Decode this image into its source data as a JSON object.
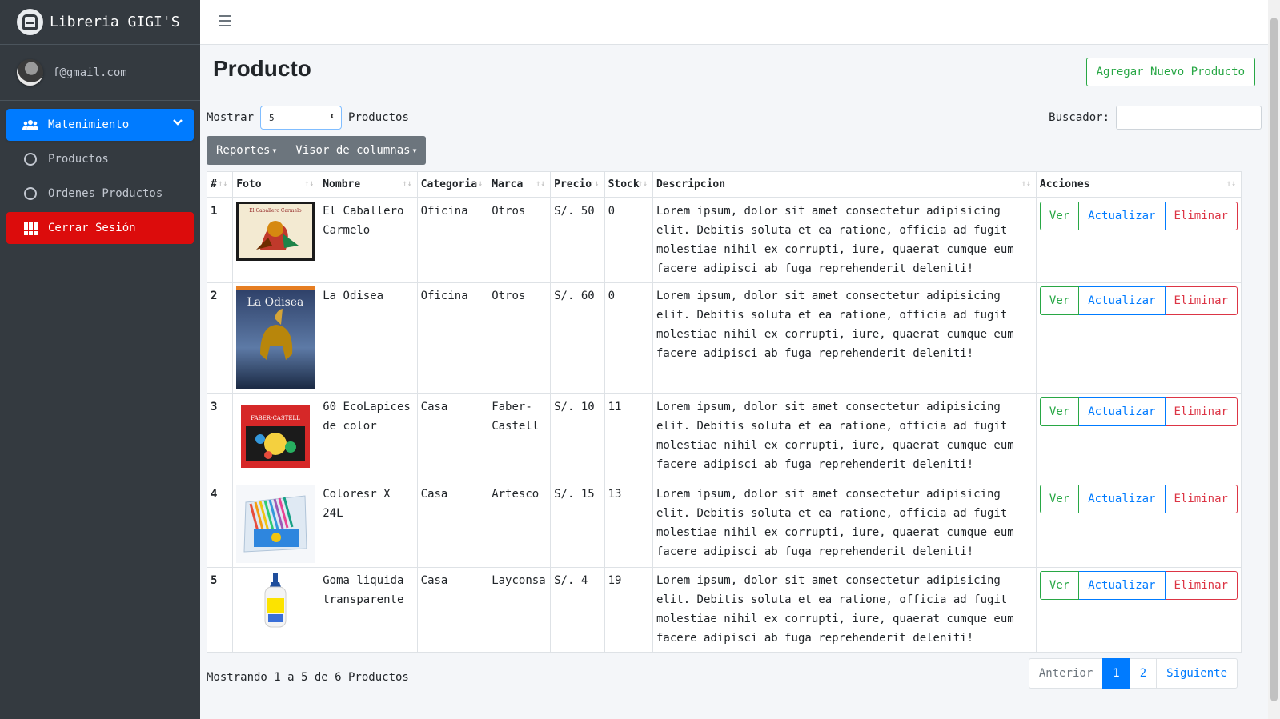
{
  "brand": {
    "name": "Libreria GIGI'S"
  },
  "user": {
    "email": "f@gmail.com"
  },
  "sidebar": {
    "items": [
      {
        "label": "Matenimiento",
        "icon": "users-icon"
      },
      {
        "label": "Productos",
        "icon": "circle-icon"
      },
      {
        "label": "Ordenes Productos",
        "icon": "circle-icon"
      },
      {
        "label": "Cerrar Sesión",
        "icon": "grid-icon"
      }
    ]
  },
  "page": {
    "title": "Producto",
    "add_button": "Agregar Nuevo Producto",
    "show_label": "Mostrar",
    "show_value": "5",
    "show_suffix": "Productos",
    "search_label": "Buscador:",
    "search_value": "",
    "reports_button": "Reportes",
    "columns_button": "Visor de columnas"
  },
  "table": {
    "headers": [
      "#",
      "Foto",
      "Nombre",
      "Categoria",
      "Marca",
      "Precio",
      "Stock",
      "Descripcion",
      "Acciones"
    ],
    "rows": [
      {
        "num": "1",
        "nombre": "El Caballero Carmelo",
        "categoria": "Oficina",
        "marca": "Otros",
        "precio": "S/. 50",
        "stock": "0",
        "descripcion": "Lorem ipsum, dolor sit amet consectetur adipisicing elit. Debitis soluta et ea ratione, officia ad fugit molestiae nihil ex corrupti, iure, quaerat cumque eum facere adipisci ab fuga reprehenderit deleniti!"
      },
      {
        "num": "2",
        "nombre": "La Odisea",
        "categoria": "Oficina",
        "marca": "Otros",
        "precio": "S/. 60",
        "stock": "0",
        "descripcion": "Lorem ipsum, dolor sit amet consectetur adipisicing elit. Debitis soluta et ea ratione, officia ad fugit molestiae nihil ex corrupti, iure, quaerat cumque eum facere adipisci ab fuga reprehenderit deleniti!"
      },
      {
        "num": "3",
        "nombre": "60 EcoLapices de color",
        "categoria": "Casa",
        "marca": "Faber-Castell",
        "precio": "S/. 10",
        "stock": "11",
        "descripcion": "Lorem ipsum, dolor sit amet consectetur adipisicing elit. Debitis soluta et ea ratione, officia ad fugit molestiae nihil ex corrupti, iure, quaerat cumque eum facere adipisci ab fuga reprehenderit deleniti!"
      },
      {
        "num": "4",
        "nombre": "Coloresr X 24L",
        "categoria": "Casa",
        "marca": "Artesco",
        "precio": "S/. 15",
        "stock": "13",
        "descripcion": "Lorem ipsum, dolor sit amet consectetur adipisicing elit. Debitis soluta et ea ratione, officia ad fugit molestiae nihil ex corrupti, iure, quaerat cumque eum facere adipisci ab fuga reprehenderit deleniti!"
      },
      {
        "num": "5",
        "nombre": "Goma liquida transparente",
        "categoria": "Casa",
        "marca": "Layconsa",
        "precio": "S/. 4",
        "stock": "19",
        "descripcion": "Lorem ipsum, dolor sit amet consectetur adipisicing elit. Debitis soluta et ea ratione, officia ad fugit molestiae nihil ex corrupti, iure, quaerat cumque eum facere adipisci ab fuga reprehenderit deleniti!"
      }
    ],
    "actions": {
      "view": "Ver",
      "update": "Actualizar",
      "delete": "Eliminar"
    }
  },
  "book_covers": {
    "caballero_title": "El Caballero Carmelo",
    "odisea_title": "La Odisea",
    "faber_brand": "FABER-CASTELL"
  },
  "footer": {
    "info": "Mostrando 1 a 5 de 6 Productos",
    "prev": "Anterior",
    "page1": "1",
    "page2": "2",
    "next": "Siguiente"
  },
  "colors": {
    "primary": "#007bff",
    "success": "#28a745",
    "danger": "#dc3545",
    "sidebar": "#343a40",
    "logout": "#dc0c0c"
  }
}
